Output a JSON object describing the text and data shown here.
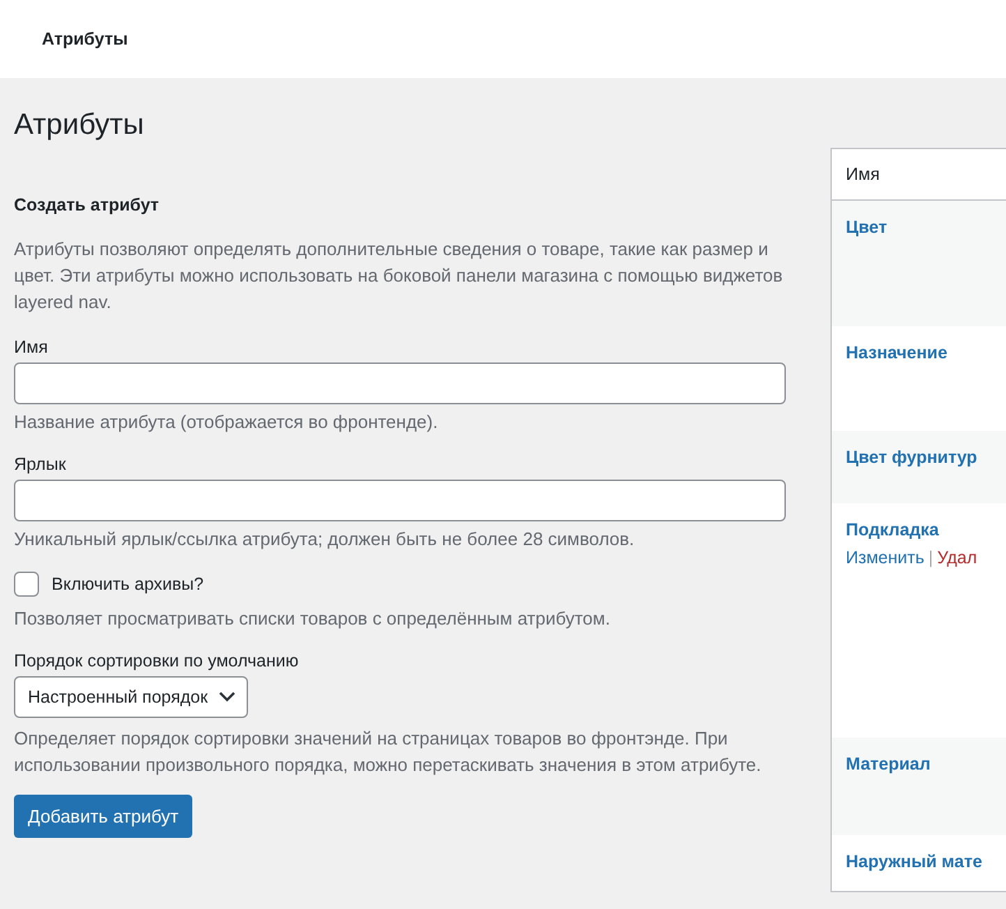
{
  "header": {
    "title": "Атрибуты"
  },
  "page_title": "Атрибуты",
  "form": {
    "heading": "Создать атрибут",
    "intro": "Атрибуты позволяют определять дополнительные сведения о товаре, такие как размер и цвет. Эти атрибуты можно использовать на боковой панели магазина с помощью виджетов layered nav.",
    "fields": [
      {
        "kind": "text",
        "label": "Имя",
        "help": "Название атрибута (отображается во фронтенде)."
      },
      {
        "kind": "text",
        "label": "Ярлык",
        "help": "Уникальный ярлык/ссылка атрибута; должен быть не более 28 символов."
      },
      {
        "kind": "checkbox",
        "label": "Включить архивы?",
        "checked": false,
        "help": "Позволяет просматривать списки товаров с определённым атрибутом."
      },
      {
        "kind": "select",
        "label": "Порядок сортировки по умолчанию",
        "value": "Настроенный порядок",
        "help": "Определяет порядок сортировки значений на страницах товаров во фронтэнде. При использовании произвольного порядка, можно перетаскивать значения в этом атрибуте."
      }
    ],
    "submit": "Добавить атрибут"
  },
  "table": {
    "columns": [
      "Имя"
    ],
    "rows": [
      {
        "name": "Цвет"
      },
      {
        "name": "Назначение"
      },
      {
        "name": "Цвет фурнитур"
      },
      {
        "name": "Подкладка",
        "actions": [
          "Изменить",
          "Удал"
        ],
        "separator": "|"
      },
      {
        "name": "Материал"
      },
      {
        "name": "Наружный мате"
      }
    ]
  }
}
